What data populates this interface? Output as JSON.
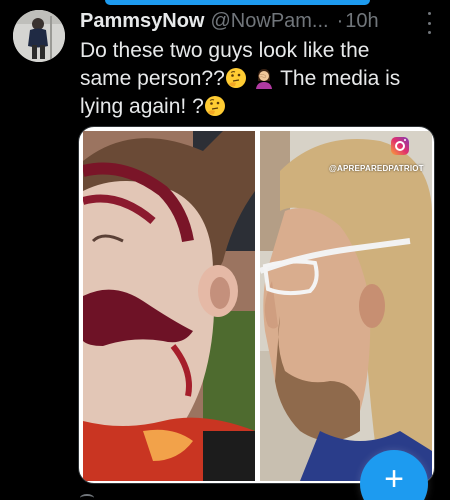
{
  "tweet": {
    "display_name": "PammsyNow",
    "handle": "@NowPam...",
    "separator": "·",
    "time": "10h",
    "text_line1": "Do these two guys look like the",
    "text_line2_a": "same person??",
    "text_line2_b": "The media is",
    "text_line3": "lying again! ?",
    "emojis": [
      "thinking-face",
      "woman-facepalming",
      "thinking-face"
    ]
  },
  "media": {
    "watermark": "@APREPAREDPATRIOT",
    "watermark_icon": "instagram-icon"
  },
  "compose_button": {
    "label": "+",
    "icon": "plus-icon"
  },
  "colors": {
    "background": "#000000",
    "text": "#e7e9ea",
    "muted": "#71767b",
    "accent": "#1d9bf0"
  }
}
